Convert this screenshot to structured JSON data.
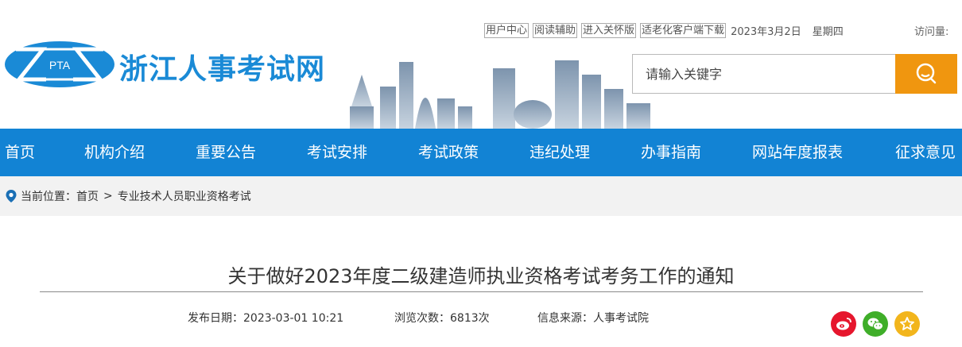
{
  "header": {
    "logo_text": "PTA",
    "site_name": "浙江人事考试网",
    "top_links": [
      "用户中心",
      "阅读辅助",
      "进入关怀版",
      "适老化客户端下载"
    ],
    "date": "2023年3月2日",
    "weekday": "星期四",
    "visits_label": "访问量:"
  },
  "search": {
    "placeholder": "请输入关键字",
    "button_icon": "search-icon"
  },
  "nav": {
    "items": [
      "首页",
      "机构介绍",
      "重要公告",
      "考试安排",
      "考试政策",
      "违纪处理",
      "办事指南",
      "网站年度报表",
      "征求意见"
    ]
  },
  "breadcrumb": {
    "label": "当前位置：",
    "home": "首页",
    "separator": ">",
    "current": "专业技术人员职业资格考试"
  },
  "article": {
    "title": "关于做好2023年度二级建造师执业资格考试考务工作的通知",
    "publish_label": "发布日期：",
    "publish_value": "2023-03-01 10:21",
    "views_label": "浏览次数：",
    "views_value": "6813次",
    "source_label": "信息来源：",
    "source_value": "人事考试院"
  },
  "share": {
    "icons": [
      "weibo-icon",
      "wechat-icon",
      "favorite-star-icon"
    ]
  },
  "colors": {
    "brand_blue": "#1a8ad6",
    "nav_blue": "#1283d4",
    "search_orange": "#f0960f",
    "weibo_red": "#e6162d",
    "wechat_green": "#3fae29",
    "star_yellow": "#f2b51c"
  }
}
